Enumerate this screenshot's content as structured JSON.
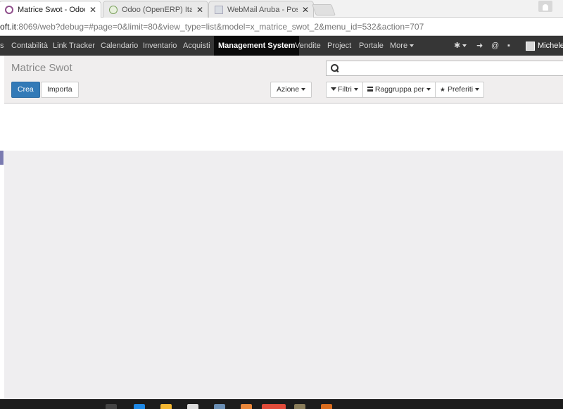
{
  "browser": {
    "tabs": [
      {
        "title": "Matrice Swot - Odoo",
        "active": true,
        "favicon": "odoo-icon"
      },
      {
        "title": "Odoo (OpenERP) Italia -",
        "active": false,
        "favicon": "leaf-icon"
      },
      {
        "title": "WebMail Aruba - Posta i",
        "active": false,
        "favicon": "mail-icon"
      }
    ],
    "close_glyph": "✕",
    "url_host": "oft.it",
    "url_path": ":8069/web?debug=#page=0&limit=80&view_type=list&model=x_matrice_swot_2&menu_id=532&action=707"
  },
  "navbar": {
    "cut_item": "s",
    "items": [
      "Contabilità",
      "Link Tracker",
      "Calendario",
      "Inventario",
      "Acquisti",
      "Management System",
      "Vendite",
      "Project",
      "Portale",
      "More"
    ],
    "active": "Management System",
    "user": "Michele"
  },
  "control_panel": {
    "title": "Matrice Swot",
    "create_label": "Crea",
    "import_label": "Importa",
    "action_label": "Azione",
    "filters_label": "Filtri",
    "groupby_label": "Raggruppa per",
    "favorites_label": "Preferiti"
  },
  "colors": {
    "navbar": "#363636",
    "primary": "#337ab7",
    "odoo_purple": "#8f4e8b"
  }
}
